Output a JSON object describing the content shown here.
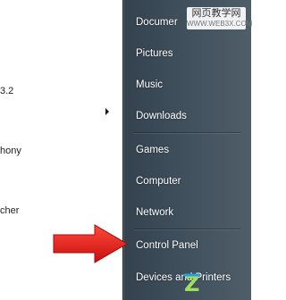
{
  "left_pane": {
    "items": [
      {
        "label": "3.2"
      },
      {
        "label": "hony"
      },
      {
        "label": "cher"
      }
    ]
  },
  "right_pane": {
    "items": [
      {
        "id": "documents",
        "label": "Documer"
      },
      {
        "id": "pictures",
        "label": "Pictures"
      },
      {
        "id": "music",
        "label": "Music"
      },
      {
        "id": "downloads",
        "label": "Downloads"
      },
      {
        "id": "games",
        "label": "Games"
      },
      {
        "id": "computer",
        "label": "Computer"
      },
      {
        "id": "network",
        "label": "Network"
      },
      {
        "id": "control-panel",
        "label": "Control Panel"
      },
      {
        "id": "devices-printers",
        "label": "Devices and Printers"
      }
    ]
  },
  "watermark": {
    "title": "网页教学网",
    "url": "WWW.WEB3X.COM"
  },
  "brand": {
    "text": "Z"
  },
  "colors": {
    "arrow": "#e21b1b",
    "menu_text": "#ffffff",
    "pane_bg": "#3f4f5c"
  }
}
